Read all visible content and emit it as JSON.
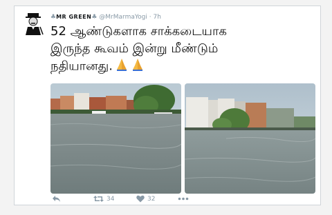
{
  "tweet": {
    "display_name": "MR GREEN",
    "handle": "@MrMarmaYogi",
    "separator": "·",
    "time": "7h",
    "text_line1": "52 ஆண்டுகளாக சாக்கடையாக",
    "text_line2": "இருந்த கூவம் இன்று மீண்டும்",
    "text_line3": "நதியானது.",
    "emojis": [
      "pray-icon",
      "pray-icon"
    ],
    "photos": [
      "flooded-river-with-buildings",
      "flooded-river-with-apartments"
    ]
  },
  "actions": {
    "reply_icon": "reply-icon",
    "retweet_icon": "retweet-icon",
    "retweet_count": "34",
    "like_icon": "heart-icon",
    "like_count": "32",
    "more_icon": "more-icon"
  },
  "colors": {
    "meta_gray": "#8899a6",
    "text": "#111111",
    "water": "#7f8d8d",
    "sky": "#c9d6de"
  }
}
